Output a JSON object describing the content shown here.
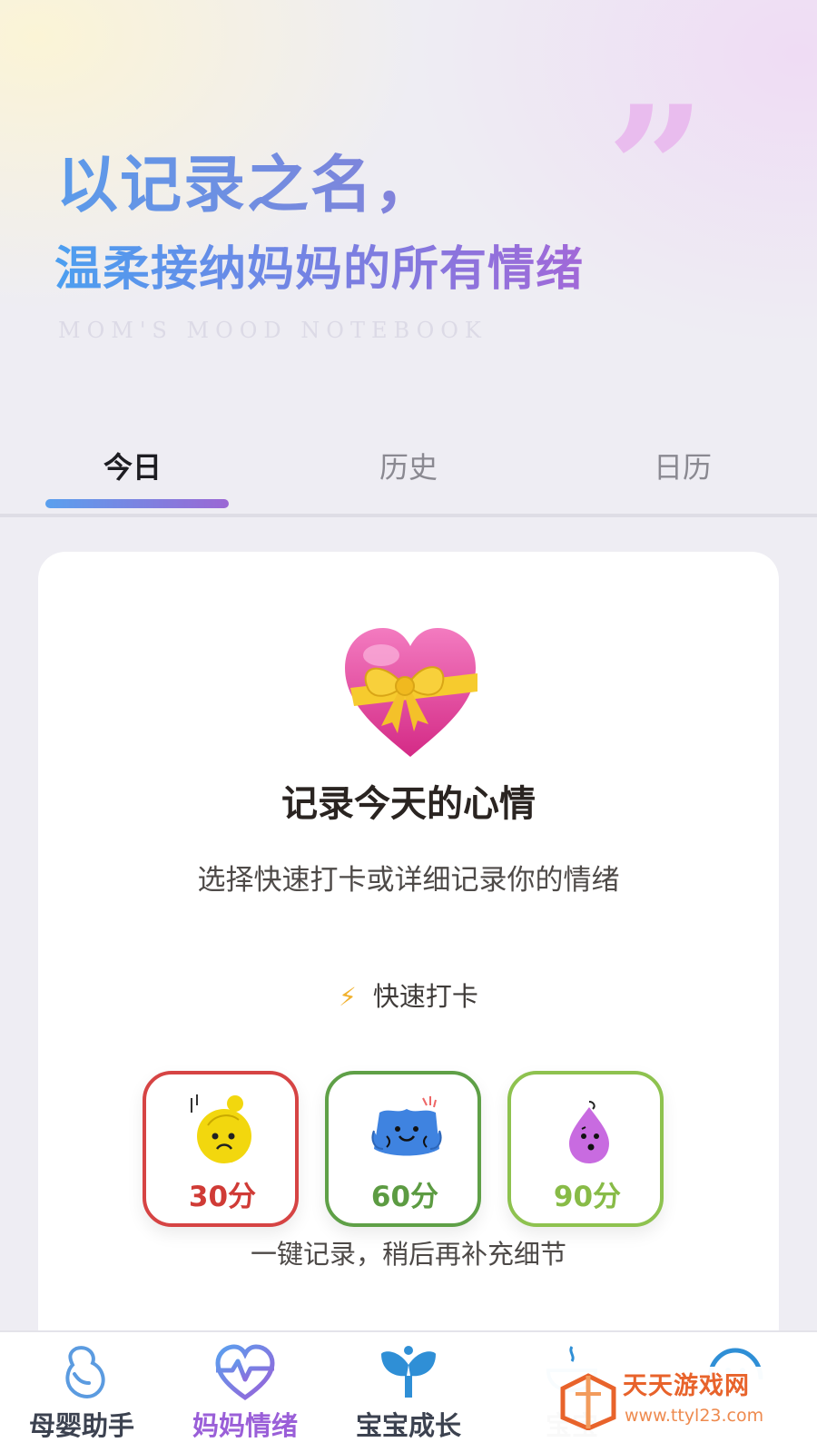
{
  "hero": {
    "headline1": "以记录之名，",
    "headline2": "温柔接纳妈妈的所有情绪",
    "subtitle_en": "MOM'S MOOD  NOTEBOOK",
    "quote_mark": "”"
  },
  "tabs": [
    {
      "label": "今日",
      "active": true
    },
    {
      "label": "历史",
      "active": false
    },
    {
      "label": "日历",
      "active": false
    }
  ],
  "card": {
    "icon": "heart-with-ribbon-icon",
    "title": "记录今天的心情",
    "description": "选择快速打卡或详细记录你的情绪",
    "quick_label": "快速打卡",
    "quick_icon": "lightning-icon",
    "scores": [
      {
        "label": "30分",
        "color": "#d03b36",
        "face": "worried-yellow-face-icon"
      },
      {
        "label": "60分",
        "color": "#5c9b42",
        "face": "happy-blue-face-icon"
      },
      {
        "label": "90分",
        "color": "#88bb47",
        "face": "purple-drop-face-icon"
      }
    ],
    "note": "一键记录，稍后再补充细节"
  },
  "nav": [
    {
      "label": "母婴助手",
      "icon": "pregnant-icon",
      "active": false
    },
    {
      "label": "妈妈情绪",
      "icon": "heartbeat-icon",
      "active": true
    },
    {
      "label": "宝宝成长",
      "icon": "sprout-icon",
      "active": false
    },
    {
      "label": "宝宝",
      "icon": "feeding-bowl-icon",
      "active": false
    },
    {
      "label": "",
      "icon": "baby-head-icon",
      "active": false
    }
  ],
  "watermark": {
    "title": "天天游戏网",
    "url": "www.ttyl23.com"
  },
  "colors": {
    "accent_purple": "#9a5fd8",
    "accent_blue": "#5aa0ee"
  }
}
